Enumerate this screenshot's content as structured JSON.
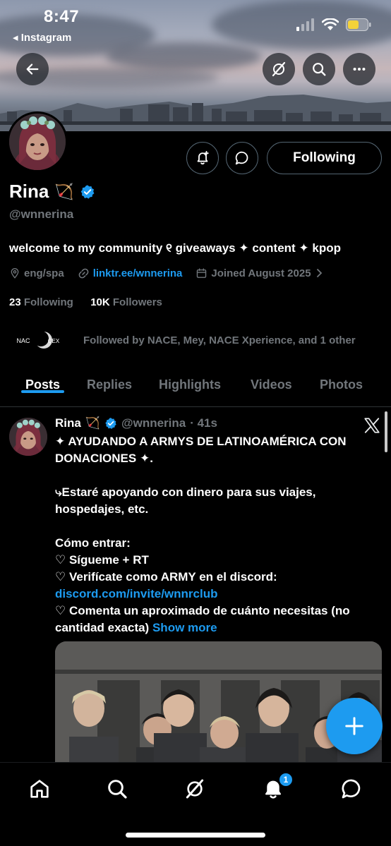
{
  "status_bar": {
    "time": "8:47",
    "back_app": "◂ Instagram"
  },
  "profile": {
    "name": "Rina",
    "name_emoji": "🏹",
    "handle": "@wnnerina",
    "following_button": "Following",
    "bio": "welcome to my community ୧ giveaways ✦ content ✦ kpop",
    "location": "eng/spa",
    "link": "linktr.ee/wnnerina",
    "joined": "Joined August 2025",
    "following_count": "23",
    "following_label": "Following",
    "followers_count": "10K",
    "followers_label": "Followers",
    "followed_by": "Followed by NACE, Mey, NACE Xperience, and 1 other",
    "mutual_avatar_1": "NACE",
    "mutual_avatar_2": "CEX"
  },
  "tabs": [
    {
      "label": "Posts",
      "active": true
    },
    {
      "label": "Replies",
      "active": false
    },
    {
      "label": "Highlights",
      "active": false
    },
    {
      "label": "Videos",
      "active": false
    },
    {
      "label": "Photos",
      "active": false
    }
  ],
  "post": {
    "name": "Rina",
    "name_emoji": "🏹",
    "handle": "@wnnerina",
    "time": "· 41s",
    "line1": "✦ AYUDANDO A ARMYS DE LATINOAMÉRICA CON DONACIONES ✦.",
    "line2": "⤷Estaré apoyando con dinero para sus viajes, hospedajes, etc.",
    "line3": "Cómo entrar:",
    "line4": "♡ Sígueme + RT",
    "line5": "♡ Verifícate como ARMY en el discord:",
    "line6": "discord.com/invite/wnnrclub",
    "line7": "♡ Comenta un aproximado de cuánto necesitas (no cantidad exacta)",
    "show_more": "Show more"
  },
  "notifications_badge": "1",
  "colors": {
    "accent": "#1d9bf0",
    "muted": "#71767b",
    "background": "#000000"
  }
}
